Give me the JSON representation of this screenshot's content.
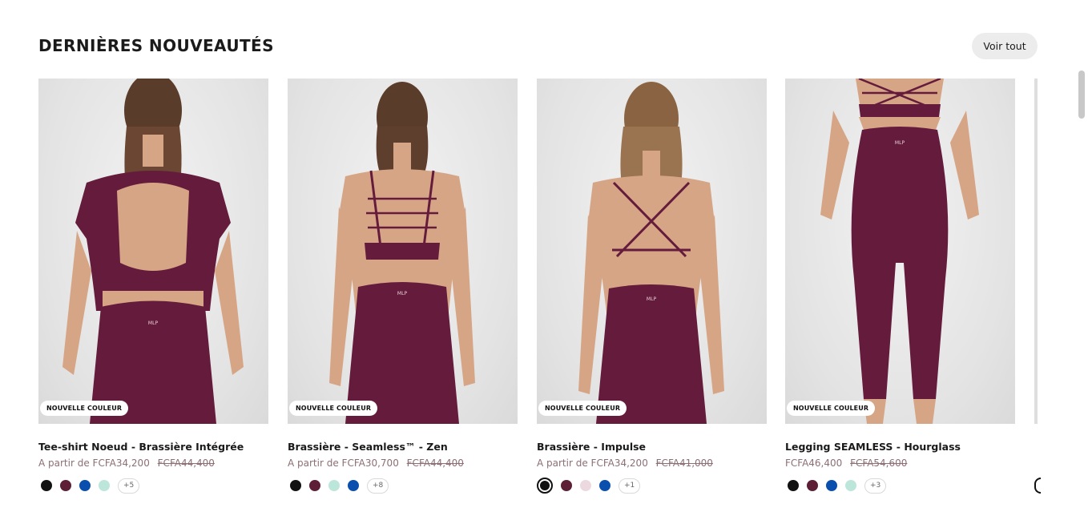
{
  "section": {
    "title": "DERNIÈRES NOUVEAUTÉS",
    "see_all_label": "Voir tout"
  },
  "products": [
    {
      "badge": "NOUVELLE COULEUR",
      "name": "Tee-shirt Noeud - Brassière Intégrée",
      "price_prefix": "A partir de",
      "price": "FCFA34,200",
      "old_price": "FCFA44,400",
      "swatches": [
        "#111111",
        "#5c1f36",
        "#0b4fae",
        "#bde6da"
      ],
      "more": "+5"
    },
    {
      "badge": "NOUVELLE COULEUR",
      "name": "Brassière - Seamless™ - Zen",
      "price_prefix": "A partir de",
      "price": "FCFA30,700",
      "old_price": "FCFA44,400",
      "swatches": [
        "#111111",
        "#5c1f36",
        "#bde6da",
        "#0b4fae"
      ],
      "more": "+8"
    },
    {
      "badge": "NOUVELLE COULEUR",
      "name": "Brassière - Impulse",
      "price_prefix": "A partir de",
      "price": "FCFA34,200",
      "old_price": "FCFA41,000",
      "swatches": [
        "#111111",
        "#5c1f36",
        "#ecd9df",
        "#0b4fae"
      ],
      "more": "+1"
    },
    {
      "badge": "NOUVELLE COULEUR",
      "name": "Legging SEAMLESS - Hourglass",
      "price_prefix": "",
      "price": "FCFA46,400",
      "old_price": "FCFA54,600",
      "swatches": [
        "#111111",
        "#5c1f36",
        "#0b4fae",
        "#bde6da"
      ],
      "more": "+3"
    }
  ],
  "colors": {
    "garment": "#651c3c",
    "skin": "#d6a585",
    "hair": "#5a3c2a",
    "price_text": "#8c6f75"
  }
}
